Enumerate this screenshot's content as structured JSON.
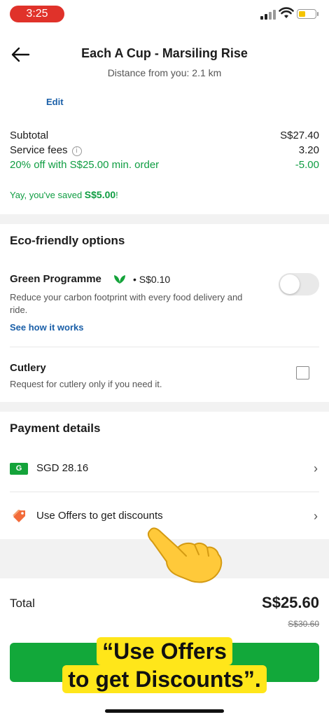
{
  "status_bar": {
    "time": "3:25"
  },
  "header": {
    "title": "Each A Cup - Marsiling Rise",
    "distance": "Distance from you: 2.1 km"
  },
  "edit_label": "Edit",
  "summary": {
    "subtotal_label": "Subtotal",
    "subtotal_value": "S$27.40",
    "service_label": "Service fees",
    "service_value": "3.20",
    "discount_label": "20% off with S$25.00 min. order",
    "discount_value": "-5.00",
    "saved_prefix": "Yay, you've saved ",
    "saved_amount": "S$5.00",
    "saved_suffix": "!"
  },
  "eco": {
    "title": "Eco-friendly options",
    "green_title": "Green Programme",
    "green_price": "• S$0.10",
    "green_desc": "Reduce your carbon footprint with every food delivery and ride.",
    "see_how": "See how it works",
    "green_enabled": false,
    "cutlery_title": "Cutlery",
    "cutlery_desc": "Request for cutlery only if you need it.",
    "cutlery_checked": false
  },
  "payment": {
    "title": "Payment details",
    "badge": "G",
    "method": "SGD 28.16",
    "offers": "Use Offers to get discounts"
  },
  "total": {
    "label": "Total",
    "value": "S$25.60",
    "original": "S$30.60"
  },
  "caption": {
    "line1": "“Use Offers",
    "line2": "to get Discounts”."
  },
  "colors": {
    "accent_green": "#12a83a",
    "link_blue": "#1a5fa8",
    "caption_yellow": "#ffe61a"
  }
}
